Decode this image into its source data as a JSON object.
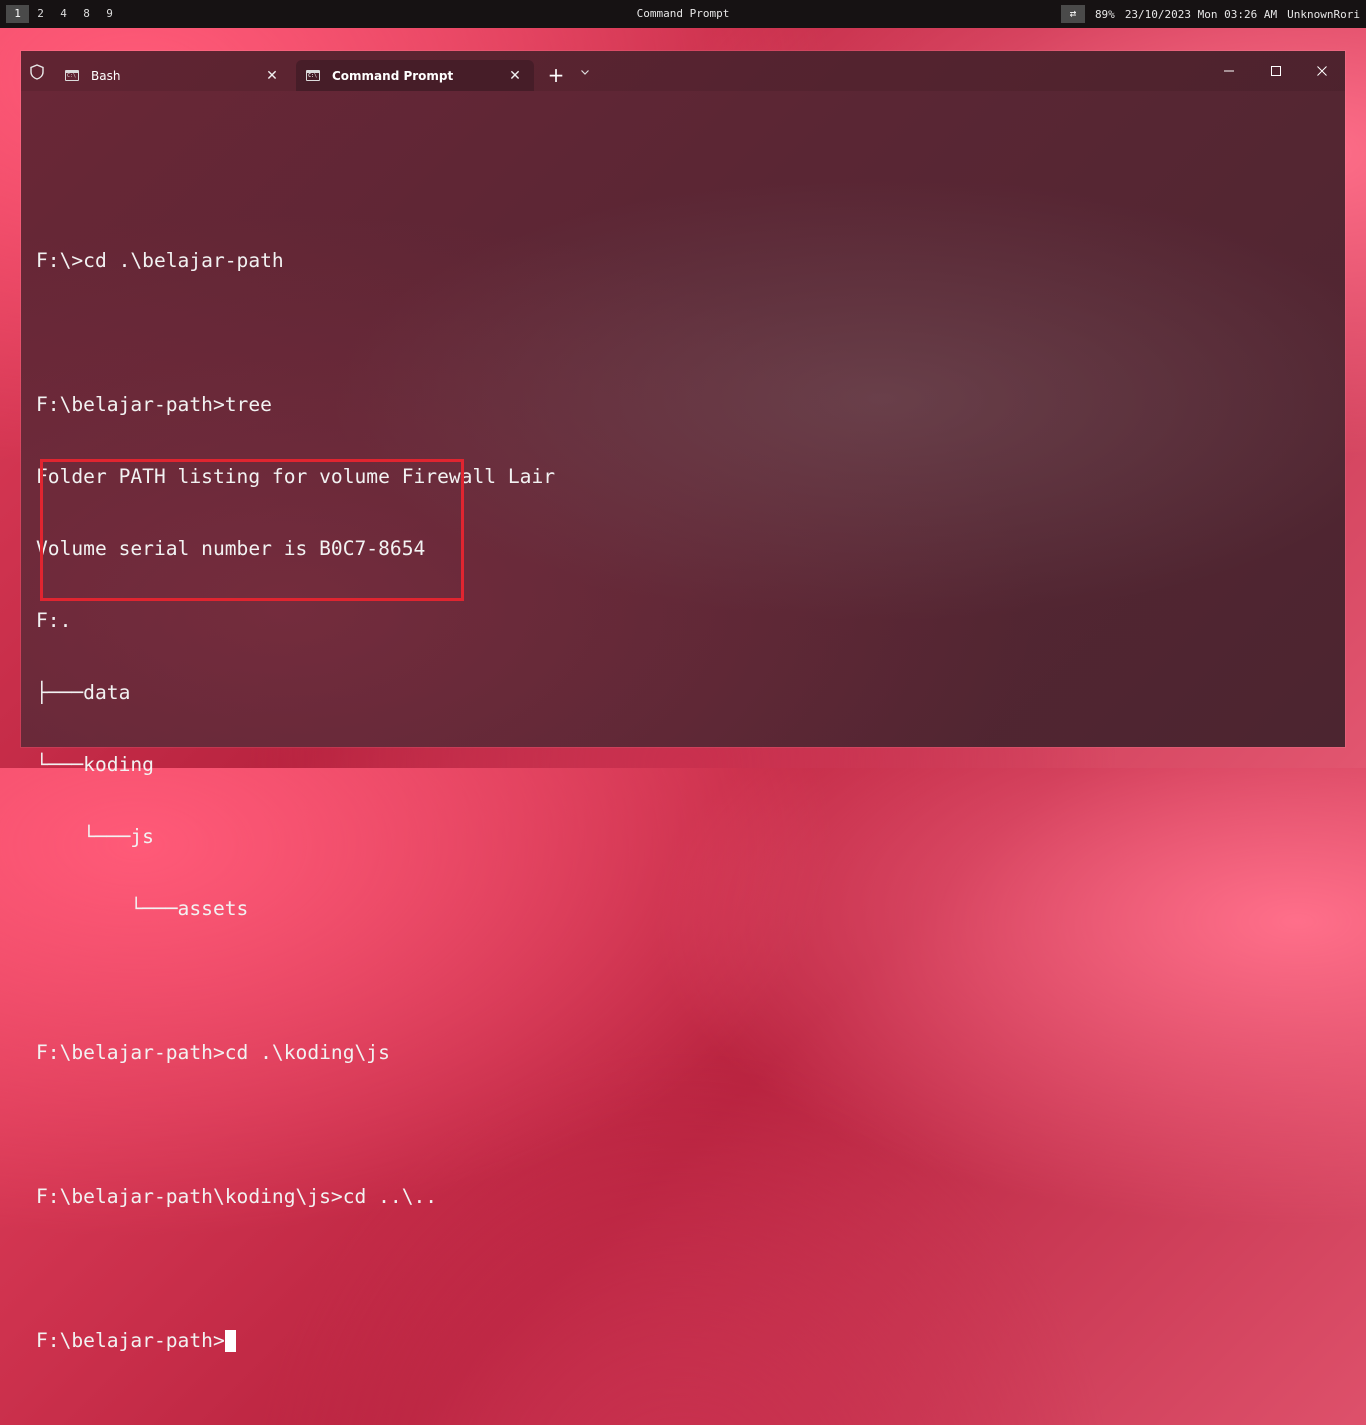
{
  "topbar": {
    "workspaces": [
      "1",
      "2",
      "4",
      "8",
      "9"
    ],
    "active_workspace": "1",
    "title": "Command Prompt",
    "tray_toggle": "⇄",
    "battery": "89%",
    "datetime": "23/10/2023 Mon 03:26 AM",
    "user": "UnknownRori"
  },
  "window": {
    "tabs": [
      {
        "label": "Bash",
        "icon": "terminal-icon",
        "active": false
      },
      {
        "label": "Command Prompt",
        "icon": "cmd-icon",
        "active": true
      }
    ],
    "new_tab_glyph": "+",
    "dropdown_glyph": "⌄",
    "close_glyph": "✕"
  },
  "terminal": {
    "lines": [
      "",
      "F:\\>cd .\\belajar-path",
      "",
      "F:\\belajar-path>tree",
      "Folder PATH listing for volume Firewall Lair",
      "Volume serial number is B0C7-8654",
      "F:.",
      "├───data",
      "└───koding",
      "    └───js",
      "        └───assets",
      "",
      "F:\\belajar-path>cd .\\koding\\js",
      "",
      "F:\\belajar-path\\koding\\js>cd ..\\..",
      "",
      "F:\\belajar-path>"
    ]
  },
  "colors": {
    "highlight_border": "#e02530",
    "active_tab": "#461e28",
    "text": "#f2f2f2"
  }
}
